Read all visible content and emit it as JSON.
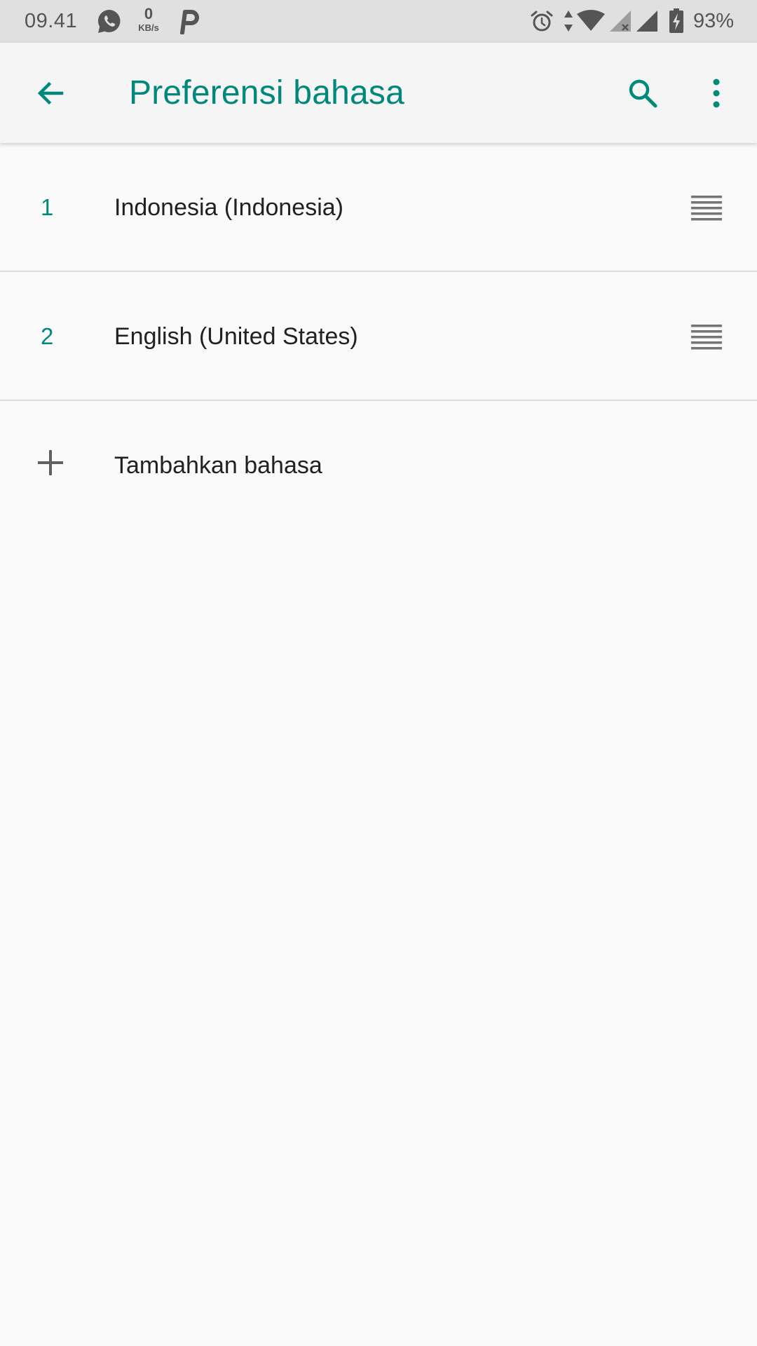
{
  "status_bar": {
    "time": "09.41",
    "speed_value": "0",
    "speed_unit": "KB/s",
    "battery_percent": "93%",
    "icons": [
      "whatsapp-icon",
      "p-app-icon",
      "alarm-icon",
      "data-arrows-icon",
      "wifi-icon",
      "signal-x-icon",
      "signal-icon",
      "battery-charging-icon"
    ]
  },
  "app_bar": {
    "title": "Preferensi bahasa",
    "back_icon": "arrow-back-icon",
    "search_icon": "search-icon",
    "more_icon": "more-vert-icon"
  },
  "languages": [
    {
      "position": "1",
      "name": "Indonesia (Indonesia)"
    },
    {
      "position": "2",
      "name": "English (United States)"
    }
  ],
  "add_language": {
    "label": "Tambahkan bahasa",
    "icon": "plus-icon"
  },
  "colors": {
    "accent": "#00897b",
    "status_bar": "#e0e0e0",
    "app_bar": "#f5f5f5",
    "background": "#fafafa",
    "divider": "#dcdcdc",
    "text_primary": "#212121"
  }
}
